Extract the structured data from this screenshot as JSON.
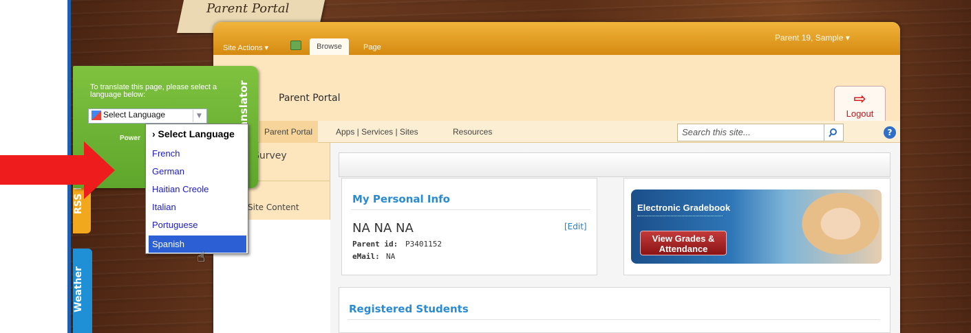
{
  "portal_tag": "Parent Portal",
  "ribbon": {
    "site_actions": "Site Actions ▾",
    "tab_browse": "Browse",
    "tab_page": "Page",
    "user": "Parent 19, Sample ▾"
  },
  "site_title": "Parent Portal",
  "logout_label": "Logout",
  "nav": {
    "current": "Parent Portal",
    "apps": "Apps | Services | Sites",
    "resources": "Resources",
    "search_placeholder": "Search this site...",
    "help": "?"
  },
  "left_nav": {
    "survey": "Survey",
    "site_content": "Site Content"
  },
  "personal_info": {
    "heading": "My Personal Info",
    "name": "NA NA NA",
    "edit": "[Edit]",
    "parent_id_label": "Parent id:",
    "parent_id_value": "P3401152",
    "email_label": "eMail:",
    "email_value": "NA"
  },
  "gradebook": {
    "title": "Electronic Gradebook",
    "button": "View Grades & Attendance"
  },
  "students": {
    "heading": "Registered Students"
  },
  "translator": {
    "tab_label": "Translator",
    "instructions": "To translate this page, please select a language below:",
    "select_value": "Select Language",
    "powered": "Power",
    "options": [
      "› Select Language",
      "French",
      "German",
      "Haitian Creole",
      "Italian",
      "Portuguese",
      "Spanish"
    ],
    "selected_index": 6
  },
  "side_tabs": {
    "rss": "RSS Ne",
    "weather": "Weather"
  },
  "colors": {
    "ribbon": "#e09a1e",
    "translator_green": "#6db334",
    "heading_blue": "#2a8bd3",
    "arrow_red": "#ee1c1c",
    "highlight": "#2c5fd3"
  }
}
